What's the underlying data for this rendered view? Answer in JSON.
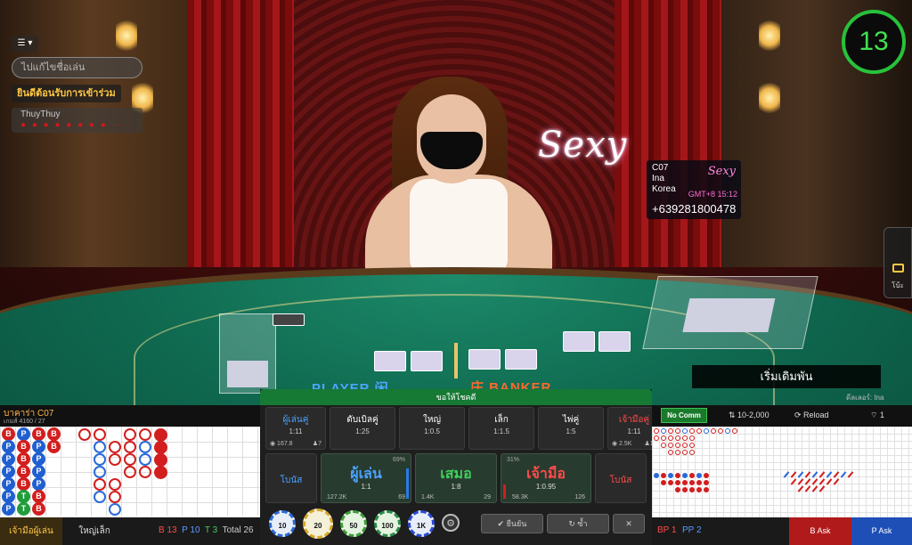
{
  "chat": {
    "toggle_label": "☰ ▾",
    "name_placeholder": "ไปแก้ไขชื่อเล่น",
    "welcome": "ยินดีต้อนรับการเข้าร่วม",
    "last_user": "ThuyThuy",
    "last_message": "● ● ● ● ● ● ● ● ···"
  },
  "timer": {
    "value": "13"
  },
  "scene": {
    "brand_logo": "Sexy",
    "player_label": "PLAYER 闲",
    "banker_label": "庄 BANKER"
  },
  "dealer_card": {
    "table": "C07",
    "name": "Ina",
    "country": "Korea",
    "gmt": "GMT+8 15:12",
    "phone": "+639281800478",
    "brand": "Sexy"
  },
  "side_chat": {
    "label": "โบ้ะ"
  },
  "start_bet": "เริ่มเดิมพัน",
  "dealer_tag": "ดีลเลอร์: Ina",
  "roadmap_left": {
    "title": "บาคาร่า C07",
    "subtitle": "เกมส์ 4160 / 27",
    "beads": [
      [
        "B",
        "P",
        "B",
        "B"
      ],
      [
        "P",
        "B",
        "P",
        "B"
      ],
      [
        "P",
        "B",
        "P"
      ],
      [
        "P",
        "B",
        "P"
      ],
      [
        "P",
        "B",
        "P"
      ],
      [
        "P",
        "T",
        "B"
      ],
      [
        "P",
        "T",
        "B"
      ]
    ],
    "tab_active": "เจ้ามือผู้เล่น",
    "tab_other": "ใหญ่เล็ก",
    "count_b": "B 13",
    "count_p": "P 10",
    "count_t": "T 3",
    "total": "Total 26"
  },
  "bet_panel": {
    "title": "ขอให้โชคดี",
    "top_bets": [
      {
        "name": "ผู้เล่นคู่",
        "odds": "1:11",
        "left": "167.8",
        "right": "7",
        "color": "#4aa3ff"
      },
      {
        "name": "ดับเบิลคู่",
        "odds": "1:25",
        "left": "",
        "right": "",
        "color": "#ffffff"
      },
      {
        "name": "ใหญ่",
        "odds": "1:0.5",
        "left": "",
        "right": "",
        "color": "#ffffff"
      },
      {
        "name": "เล็ก",
        "odds": "1:1.5",
        "left": "",
        "right": "",
        "color": "#ffffff"
      },
      {
        "name": "ไพ่คู่",
        "odds": "1:5",
        "left": "",
        "right": "",
        "color": "#ffffff"
      },
      {
        "name": "เจ้ามือคู่",
        "odds": "1:11",
        "left": "2.5K",
        "right": "11",
        "color": "#ff4b4b"
      }
    ],
    "bonus_left": "โบนัส",
    "bonus_right": "โบนัส",
    "player": {
      "name": "ผู้เล่น",
      "odds": "1:1",
      "pct": "69%",
      "left": "127.2K",
      "right": "69"
    },
    "tie": {
      "name": "เสมอ",
      "odds": "1:8",
      "left": "1.4K",
      "right": "29"
    },
    "banker": {
      "name": "เจ้ามือ",
      "odds": "1:0.95",
      "pct": "31%",
      "left": "58.3K",
      "right": "126"
    },
    "chips": [
      "10",
      "20",
      "50",
      "100",
      "1K"
    ],
    "confirm": "✔ ยืนยัน",
    "repeat": "↻ ซ้ำ",
    "cancel": "✕"
  },
  "roadmap_right": {
    "no_comm": "No Comm",
    "limit": "⇅ 10-2,000",
    "reload": "⟳ Reload",
    "wifi": "⌔ 1",
    "bp": "BP 1",
    "pp": "PP 2",
    "b_ask": "B Ask",
    "p_ask": "P Ask"
  },
  "colors": {
    "banker": "#d21e1e",
    "player": "#1f5fd1",
    "tie": "#1f9d3a",
    "timer": "#3fe24f"
  }
}
